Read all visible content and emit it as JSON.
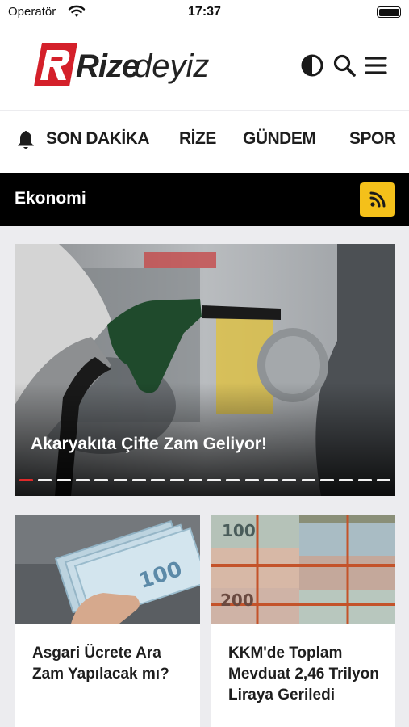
{
  "status_bar": {
    "carrier": "Operatör",
    "time": "17:37"
  },
  "header": {
    "logo_part1": "Rize",
    "logo_part2": "deyiz",
    "icons": [
      "contrast-icon",
      "search-icon",
      "menu-icon"
    ]
  },
  "nav": {
    "items": [
      {
        "label": "SON DAKİKA",
        "icon": "bell-icon"
      },
      {
        "label": "RİZE"
      },
      {
        "label": "GÜNDEM"
      },
      {
        "label": "SPOR"
      }
    ]
  },
  "section": {
    "title": "Ekonomi",
    "rss_icon": "rss-icon"
  },
  "hero": {
    "title": "Akaryakıta Çifte Zam Geliyor!",
    "slide_count": 20,
    "active_slide": 1
  },
  "cards": [
    {
      "title": "Asgari Ücrete Ara Zam Yapılacak mı?"
    },
    {
      "title": "KKM'de Toplam Mevduat 2,46 Trilyon Liraya Geriledi"
    }
  ],
  "colors": {
    "accent_red": "#d4202a",
    "rss_yellow": "#f4c01a",
    "section_bar": "#000000",
    "page_bg": "#ececef"
  }
}
